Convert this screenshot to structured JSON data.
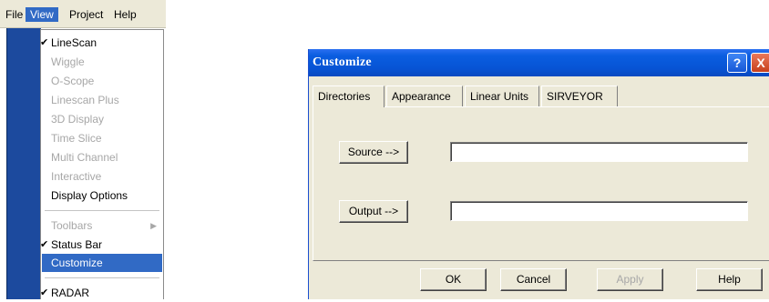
{
  "menubar": {
    "items": [
      "File",
      "View",
      "Project",
      "Help"
    ],
    "active": "View"
  },
  "view_menu": {
    "items": [
      {
        "label": "LineScan",
        "checked": true,
        "enabled": true
      },
      {
        "label": "Wiggle",
        "enabled": false
      },
      {
        "label": "O-Scope",
        "enabled": false
      },
      {
        "label": "Linescan Plus",
        "enabled": false
      },
      {
        "label": "3D Display",
        "enabled": false
      },
      {
        "label": "Time Slice",
        "enabled": false
      },
      {
        "label": "Multi Channel",
        "enabled": false
      },
      {
        "label": "Interactive",
        "enabled": false
      },
      {
        "label": "Display Options",
        "enabled": true
      },
      {
        "label": "Toolbars",
        "enabled": false,
        "submenu": true
      },
      {
        "label": "Status Bar",
        "checked": true,
        "enabled": true
      },
      {
        "label": "Customize",
        "enabled": true,
        "highlighted": true
      },
      {
        "label": "RADAR",
        "checked": true,
        "enabled": true
      }
    ]
  },
  "dialog": {
    "title": "Customize",
    "help_glyph": "?",
    "close_glyph": "X",
    "tabs": [
      "Directories",
      "Appearance",
      "Linear Units",
      "SIRVEYOR"
    ],
    "active_tab": "Directories",
    "source_button": "Source -->",
    "source_value": "",
    "output_button": "Output -->",
    "output_value": "",
    "buttons": {
      "ok": "OK",
      "cancel": "Cancel",
      "apply": "Apply",
      "help": "Help"
    }
  },
  "colors": {
    "menu_highlight": "#316ac5",
    "title_bar": "#0a5de0",
    "dialog_face": "#ece9d8",
    "app_strip": "#1c4a9e"
  }
}
